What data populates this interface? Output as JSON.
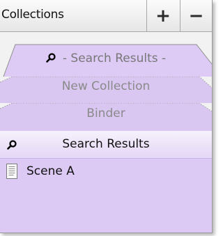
{
  "header": {
    "title": "Collections",
    "add_label": "+",
    "remove_label": "−"
  },
  "tabs": [
    {
      "label": "- Search Results -",
      "icon": "magnifier-icon",
      "active": true
    },
    {
      "label": "New Collection",
      "active": false
    },
    {
      "label": "Binder",
      "active": false
    }
  ],
  "selected_row": {
    "label": "Search Results",
    "icon": "magnifier-icon"
  },
  "list": [
    {
      "label": "Scene A",
      "icon": "document-icon"
    }
  ],
  "colors": {
    "panel_bg": "#dccaf4",
    "header_bg": "#eeeeee"
  }
}
